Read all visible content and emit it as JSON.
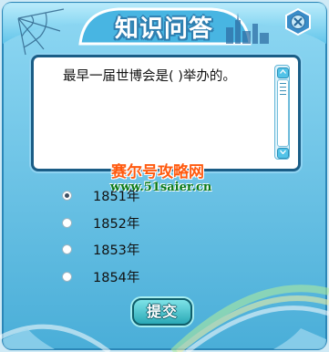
{
  "dialog": {
    "title": "知识问答"
  },
  "question": {
    "text": "最早一届世博会是( )举办的。"
  },
  "options": [
    {
      "label": "1851年",
      "selected": true
    },
    {
      "label": "1852年",
      "selected": false
    },
    {
      "label": "1853年",
      "selected": false
    },
    {
      "label": "1854年",
      "selected": false
    }
  ],
  "submit_label": "提交",
  "watermark": {
    "site_name": "赛尔号攻略网",
    "url": "www.51saier.cn"
  },
  "icons": {
    "close": "close-icon",
    "scroll_up": "chevron-up-icon",
    "scroll_down": "chevron-down-icon",
    "web": "spider-web-icon",
    "skyline": "city-skyline-icon"
  },
  "colors": {
    "frame_blue": "#5db7dc",
    "panel_border": "#1a5d86",
    "submit_teal": "#2aa9b6",
    "watermark_orange": "#ff5a0f",
    "watermark_green": "#0c7a17"
  }
}
